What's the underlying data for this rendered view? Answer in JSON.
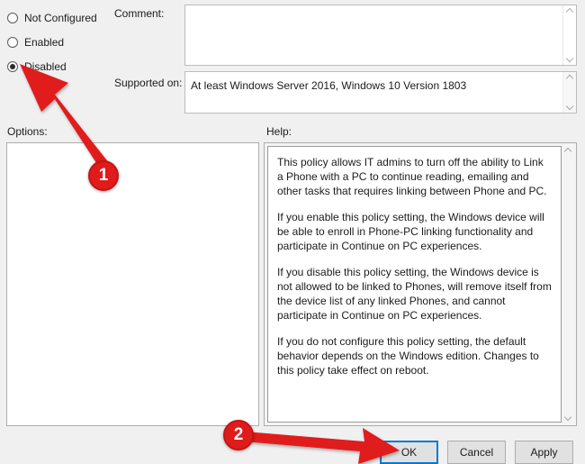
{
  "dialog": {
    "state_options": [
      {
        "label": "Not Configured",
        "selected": false
      },
      {
        "label": "Enabled",
        "selected": false
      },
      {
        "label": "Disabled",
        "selected": true
      }
    ],
    "comment": {
      "label": "Comment:",
      "value": "",
      "placeholder": ""
    },
    "supported_on": {
      "label": "Supported on:",
      "value": "At least Windows Server 2016, Windows 10 Version 1803"
    },
    "options": {
      "label": "Options:",
      "value": ""
    },
    "help": {
      "label": "Help:",
      "paragraphs": [
        "This policy allows IT admins to turn off the ability to Link a Phone with a PC to continue reading, emailing and other tasks that requires linking between Phone and PC.",
        "If you enable this policy setting, the Windows device will be able to enroll in Phone-PC linking functionality and participate in Continue on PC experiences.",
        "If you disable this policy setting, the Windows device is not allowed to be linked to Phones, will remove itself from the device list of any linked Phones, and cannot participate in Continue on PC experiences.",
        "If you do not configure this policy setting, the default behavior depends on the Windows edition. Changes to this policy take effect on reboot."
      ]
    },
    "buttons": {
      "ok": "OK",
      "cancel": "Cancel",
      "apply": "Apply"
    }
  },
  "annotations": {
    "colors": {
      "marker": "#e01b1b",
      "marker_border": "#c51414",
      "focus": "#0078d7"
    },
    "steps": [
      {
        "number": "1",
        "points_to": "disabled-radio"
      },
      {
        "number": "2",
        "points_to": "ok-button"
      }
    ]
  }
}
